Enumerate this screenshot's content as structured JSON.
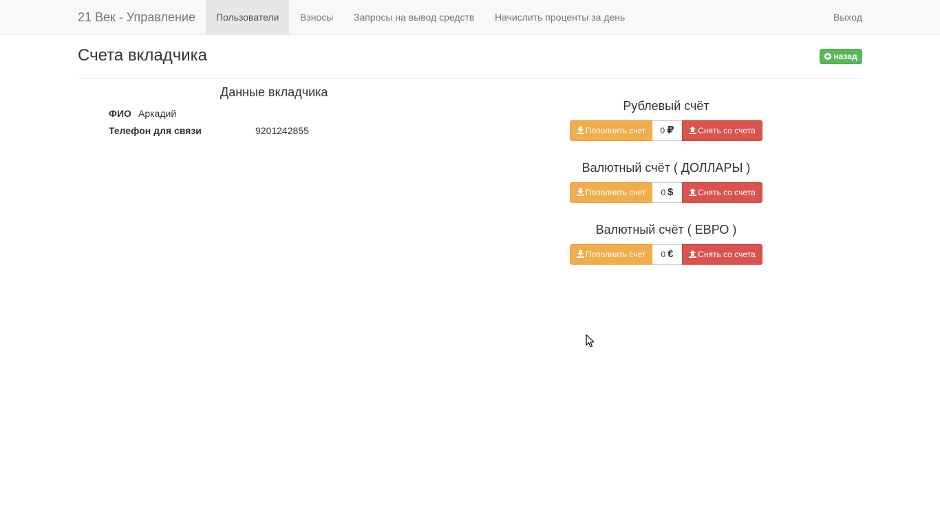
{
  "navbar": {
    "brand": "21 Век - Управление",
    "items": [
      {
        "label": "Пользователи",
        "active": true
      },
      {
        "label": "Взносы",
        "active": false
      },
      {
        "label": "Запросы на вывод средств",
        "active": false
      },
      {
        "label": "Начислить проценты за день",
        "active": false
      }
    ],
    "logout": "Выход"
  },
  "page": {
    "title": "Счета вкладчика",
    "back_label": "назад",
    "back_icon": "arrow-left-icon"
  },
  "depositor": {
    "title": "Данные вкладчика",
    "fio_label": "ФИО",
    "fio_value": "Аркадий",
    "phone_label": "Телефон для связи",
    "phone_value": "9201242855"
  },
  "accounts": [
    {
      "title": "Рублевый счёт",
      "deposit_label": "Пополнить счет",
      "balance": "0",
      "currency_symbol": "₽",
      "withdraw_label": "Снять со счета"
    },
    {
      "title": "Валютный счёт ( ДОЛЛАРЫ )",
      "deposit_label": "Пополнить счет",
      "balance": "0",
      "currency_symbol": "$",
      "withdraw_label": "Снять со счета"
    },
    {
      "title": "Валютный счёт ( ЕВРО )",
      "deposit_label": "Пополнить счет",
      "balance": "0",
      "currency_symbol": "€",
      "withdraw_label": "Снять со счета"
    }
  ],
  "colors": {
    "navbar_bg": "#f8f8f8",
    "active_nav_bg": "#e7e7e7",
    "success": "#5cb85c",
    "warning": "#f0ad4e",
    "danger": "#d9534f"
  },
  "icons": {
    "deposit": "import-icon",
    "withdraw": "export-icon"
  }
}
